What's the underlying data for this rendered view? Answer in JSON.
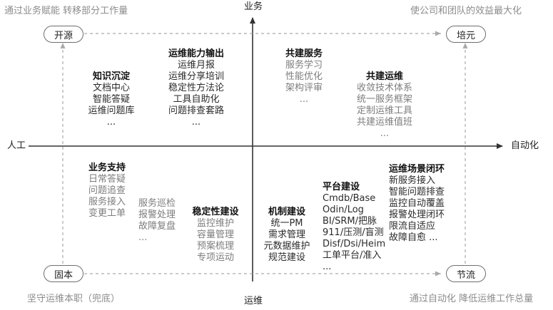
{
  "axes": {
    "top": "业务",
    "bottom": "运维",
    "left": "人工",
    "right": "自动化"
  },
  "corners": {
    "top_left": "通过业务赋能 转移部分工作量",
    "top_right": "使公司和团队的效益最大化",
    "bottom_left": "坚守运维本职（兜底）",
    "bottom_right": "通过自动化 降低运维工作总量"
  },
  "pills": {
    "top_left": "开源",
    "top_right": "培元",
    "bottom_left": "固本",
    "bottom_right": "节流"
  },
  "groups": {
    "knowledge": {
      "title": "知识沉淀",
      "items": [
        "文档中心",
        "智能答疑",
        "运维问题库",
        "..."
      ]
    },
    "ops_output": {
      "title": "运维能力输出",
      "items": [
        "运维月报",
        "运维分享培训",
        "稳定性方法论",
        "工具自助化",
        "问题排查套路",
        "..."
      ]
    },
    "shared_service": {
      "title": "共建服务",
      "items": [
        "服务学习",
        "性能优化",
        "架构评审",
        "..."
      ]
    },
    "shared_ops": {
      "title": "共建运维",
      "items": [
        "收敛技术体系",
        "统一服务框架",
        "定制运维工具",
        "共建运维值班",
        "..."
      ]
    },
    "biz_support": {
      "title": "业务支持",
      "items": [
        "日常答疑",
        "问题追查",
        "服务接入",
        "变更工单"
      ]
    },
    "inspection": {
      "items": [
        "服务巡检",
        "报警处理",
        "故障复盘",
        "..."
      ]
    },
    "stability": {
      "title": "稳定性建设",
      "items": [
        "监控维护",
        "容量管理",
        "预案梳理",
        "专项运动"
      ]
    },
    "mechanism": {
      "title": "机制建设",
      "items": [
        "统一PM",
        "需求管理",
        "元数据维护",
        "规范建设"
      ]
    },
    "platform": {
      "title": "平台建设",
      "items": [
        "Cmdb/Base",
        "Odin/Log",
        "BI/SRM/把脉",
        "911/压测/盲测",
        "Disf/Dsi/Heim",
        "工单平台/准入",
        "..."
      ]
    },
    "scenario": {
      "title": "运维场景闭环",
      "items": [
        "新服务接入",
        "智能问题排查",
        "监控自动覆盖",
        "报警处理闭环",
        "限流自适应",
        "故障自愈 ..."
      ]
    }
  }
}
